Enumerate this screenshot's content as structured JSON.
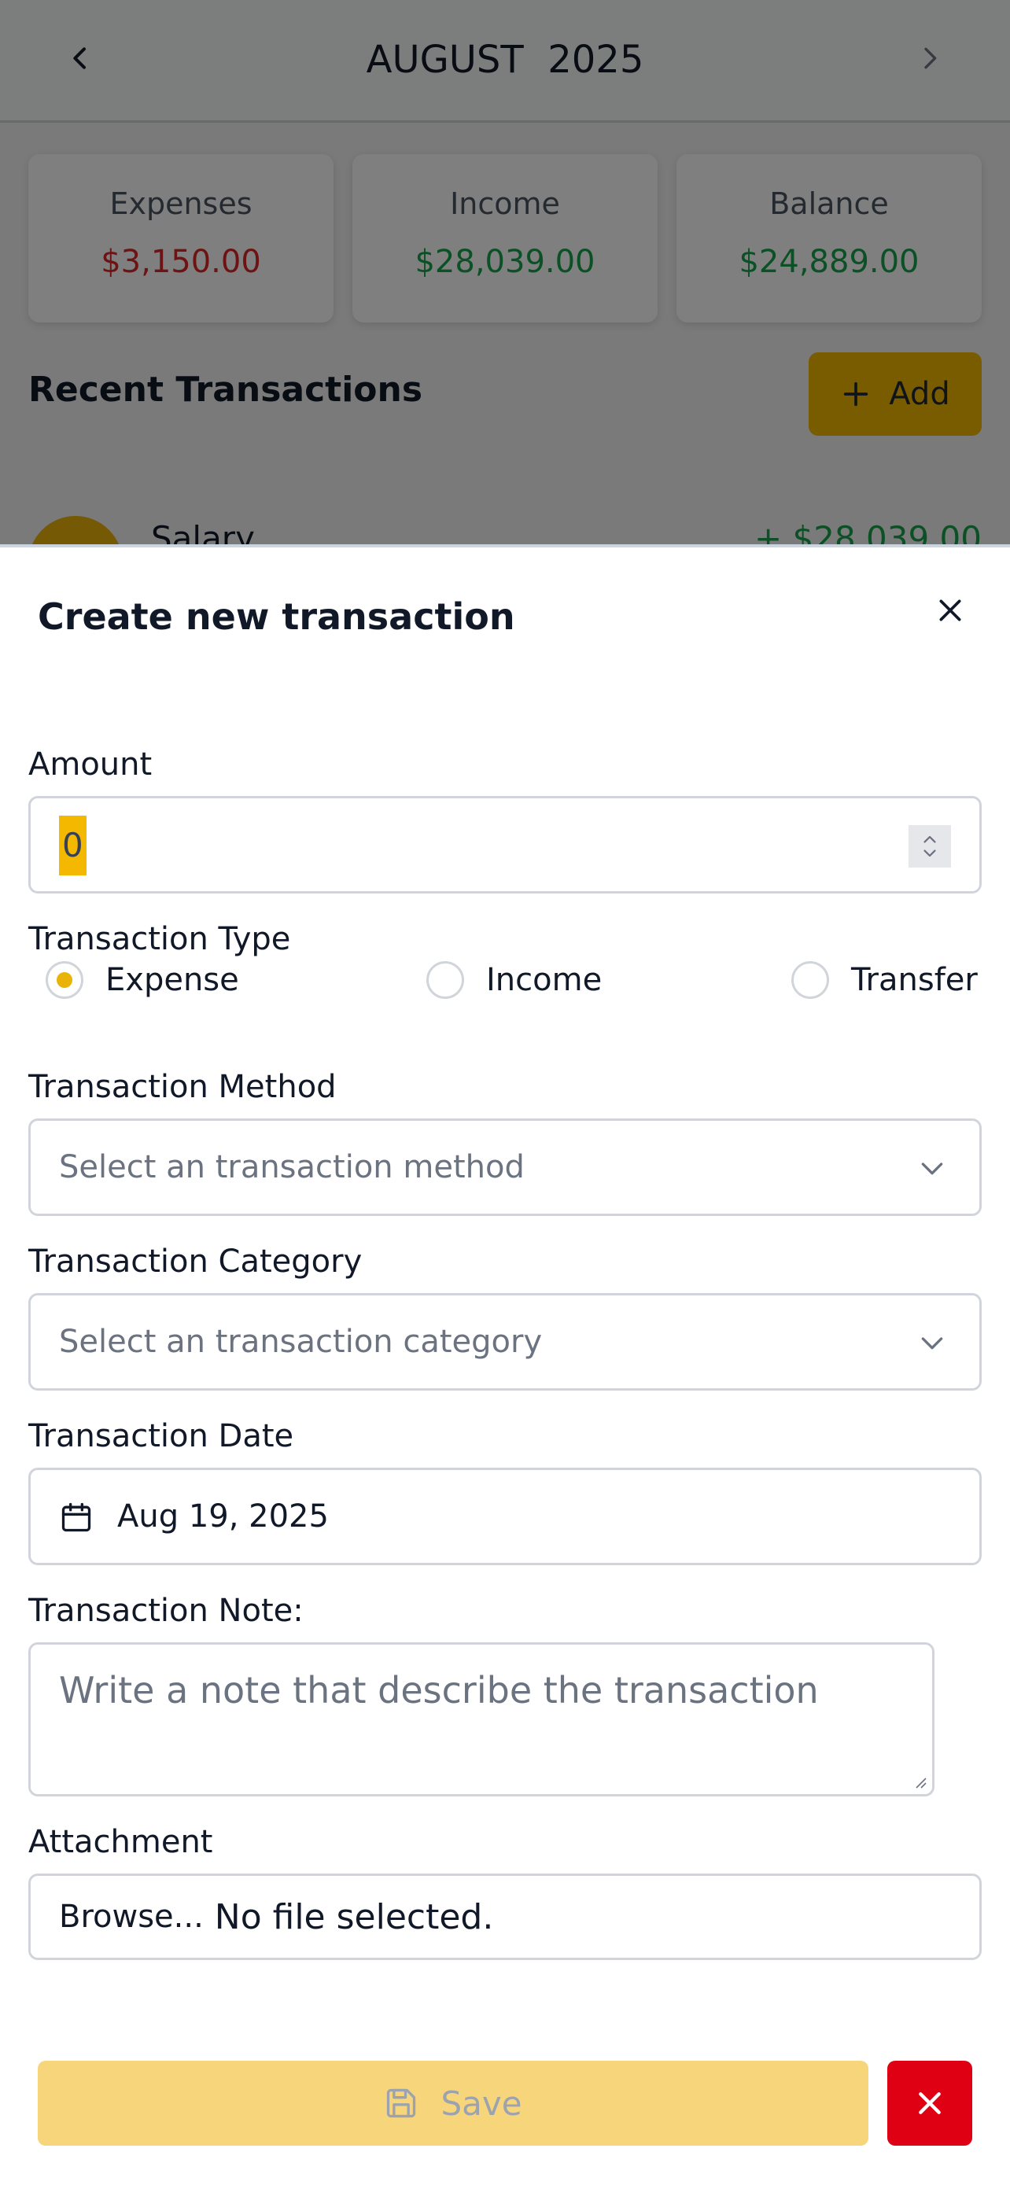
{
  "header": {
    "month_title": "AUGUST  2025"
  },
  "summary": {
    "expenses": {
      "label": "Expenses",
      "value": "$3,150.00",
      "color": "#dc2626"
    },
    "income": {
      "label": "Income",
      "value": "$28,039.00",
      "color": "#16a34a"
    },
    "balance": {
      "label": "Balance",
      "value": "$24,889.00",
      "color": "#16a34a"
    }
  },
  "recent": {
    "title": "Recent Transactions",
    "add_label": "Add",
    "items": [
      {
        "name": "Salary",
        "amount": "+ $28,039.00"
      }
    ]
  },
  "modal": {
    "title": "Create new transaction",
    "amount": {
      "label": "Amount",
      "value": "0"
    },
    "type": {
      "label": "Transaction Type",
      "options": [
        "Expense",
        "Income",
        "Transfer"
      ],
      "selected": "Expense"
    },
    "method": {
      "label": "Transaction Method",
      "placeholder": "Select an transaction method"
    },
    "category": {
      "label": "Transaction Category",
      "placeholder": "Select an transaction category"
    },
    "date": {
      "label": "Transaction Date",
      "value": "Aug 19, 2025"
    },
    "note": {
      "label": "Transaction Note:",
      "placeholder": "Write a note that describe the transaction"
    },
    "attachment": {
      "label": "Attachment",
      "browse": "Browse...",
      "status": "No file selected."
    },
    "save_label": "Save"
  },
  "colors": {
    "accent": "#f5b800",
    "danger": "#e00014",
    "save_disabled": "#f7d57a"
  }
}
